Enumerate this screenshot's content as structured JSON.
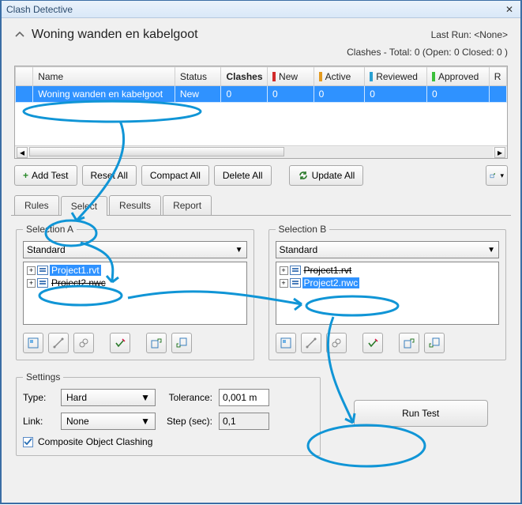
{
  "window": {
    "title": "Clash Detective"
  },
  "header": {
    "section_title": "Woning wanden en kabelgoot",
    "last_run_label": "Last Run:",
    "last_run_value": "<None>",
    "summary": "Clashes - Total: 0 (Open: 0  Closed: 0 )"
  },
  "grid": {
    "columns": {
      "name": "Name",
      "status": "Status",
      "clashes": "Clashes",
      "new": "New",
      "active": "Active",
      "reviewed": "Reviewed",
      "approved": "Approved",
      "r": "R"
    },
    "colors": {
      "new": "#d12a2a",
      "active": "#e39a1f",
      "reviewed": "#2aa0d1",
      "approved": "#3bbf3b"
    },
    "rows": [
      {
        "name": "Woning wanden en kabelgoot",
        "status": "New",
        "clashes": "0",
        "new": "0",
        "active": "0",
        "reviewed": "0",
        "approved": "0",
        "r": ""
      }
    ]
  },
  "toolbar": {
    "add_test": "Add Test",
    "reset_all": "Reset All",
    "compact_all": "Compact All",
    "delete_all": "Delete All",
    "update_all": "Update All"
  },
  "tabs": {
    "rules": "Rules",
    "select": "Select",
    "results": "Results",
    "report": "Report"
  },
  "selection_a": {
    "legend": "Selection A",
    "dropdown": "Standard",
    "items": [
      {
        "label": "Project1.rvt",
        "selected": true,
        "strike": false
      },
      {
        "label": "Project2.nwc",
        "selected": false,
        "strike": true
      }
    ]
  },
  "selection_b": {
    "legend": "Selection B",
    "dropdown": "Standard",
    "items": [
      {
        "label": "Project1.rvt",
        "selected": false,
        "strike": true
      },
      {
        "label": "Project2.nwc",
        "selected": true,
        "strike": false
      }
    ]
  },
  "settings": {
    "legend": "Settings",
    "type_label": "Type:",
    "type_value": "Hard",
    "tolerance_label": "Tolerance:",
    "tolerance_value": "0,001 m",
    "link_label": "Link:",
    "link_value": "None",
    "step_label": "Step (sec):",
    "step_value": "0,1",
    "composite_label": "Composite Object Clashing",
    "composite_checked": true
  },
  "run": {
    "label": "Run Test"
  }
}
